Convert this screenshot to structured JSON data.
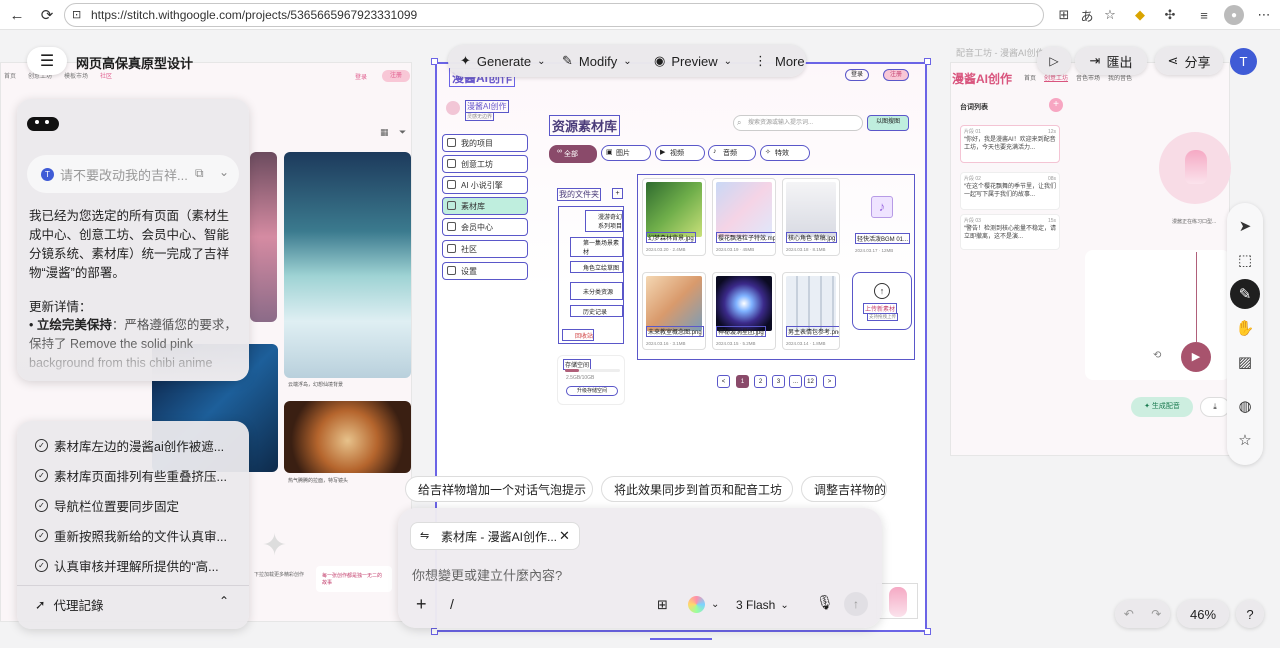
{
  "browser": {
    "url": "https://stitch.withgoogle.com/projects/5365665967923331099",
    "avatar_initial": "T"
  },
  "toolbar": {
    "menu_title": "网页高保真原型设计",
    "generate": "Generate",
    "modify": "Modify",
    "preview": "Preview",
    "more": "More",
    "export": "匯出",
    "share": "分享",
    "avatar": "T"
  },
  "left_panel": {
    "input_placeholder": "请不要改动我的吉祥...",
    "message_intro": "我已经为您选定的所有页面（素材生成中心、创意工坊、会员中心、智能分镜系统、素材库）统一完成了吉祥物“漫酱”的部署。",
    "update_heading": "更新详情：",
    "bullet_bold": "立绘完美保持",
    "bullet_text": "：严格遵循您的要求，保持了 Remove the solid pink background from this chibi anime",
    "todos": [
      "素材库左边的漫酱ai创作被遮...",
      "素材库页面排列有些重叠挤压...",
      "导航栏位置要同步固定",
      "重新按照我新给的文件认真审...",
      "认真审核并理解所提供的“高..."
    ],
    "agent_log": "代理記錄"
  },
  "bg_page_left": {
    "nav": [
      "首页",
      "创意工坊",
      "模板市场",
      "社区"
    ],
    "login": "登录",
    "register": "注册",
    "caption1": "云端浮岛，幻想仙境背景",
    "caption2": "热气腾腾的拉面，特写镜头",
    "bottom_text": "下拉加载更多精彩创作",
    "bottom_card": "每一张创作都是独一无二的故事"
  },
  "frame": {
    "brand": "漫酱AI创作",
    "brand_sub": "灵感无边界",
    "title": "资源素材库",
    "search_placeholder": "搜索资源或输入提示词...",
    "upload_btn": "以图搜图",
    "login": "登录",
    "register": "注册",
    "sidebar": [
      "我的项目",
      "创意工坊",
      "AI 小说引擎",
      "素材库",
      "会员中心",
      "社区",
      "设置"
    ],
    "filters": [
      "全部",
      "图片",
      "视频",
      "音频",
      "特效"
    ],
    "folder_title": "我的文件夹",
    "folders": [
      "漫游奇幻系列项目",
      "第一集场景素材",
      "角色立绘草图",
      "未分类资源",
      "历史记录",
      "回收站"
    ],
    "storage_title": "存储空间",
    "storage_value": "2.5GB/10GB",
    "storage_btn": "升级存储空间",
    "assets": [
      {
        "name": "幻梦森林背景.jpg",
        "meta": "2024.03.20 · 2.4MB"
      },
      {
        "name": "樱花飘落粒子特效.mp4",
        "meta": "2024.03.19 · 45MB"
      },
      {
        "name": "核心角色 草稿.jpg",
        "meta": "2024.03.18 · 8.1MB"
      },
      {
        "name": "轻快活泼BGM 01...",
        "meta": "2024.03.17 · 12MB"
      },
      {
        "name": "未来教室概念图.png",
        "meta": "2024.03.16 · 3.1MB"
      },
      {
        "name": "神秘漩涡星团.jpg",
        "meta": "2024.03.15 · 5.2MB"
      },
      {
        "name": "男主表情包参考.png",
        "meta": "2024.03.14 · 1.8MB"
      }
    ],
    "upload_card_title": "上传新素材",
    "upload_card_sub": "支持拖拽上传",
    "pages": [
      "<",
      "1",
      "2",
      "3",
      "...",
      "12",
      ">"
    ]
  },
  "suggestions": [
    {
      "text": "给吉祥物增加一个对话气泡提示",
      "n": "1"
    },
    {
      "text": "将此效果同步到首页和配音工坊",
      "n": "2"
    },
    {
      "text": "调整吉祥物的大小",
      "n": ""
    }
  ],
  "composer": {
    "context_chip": "素材库 - 漫酱AI创作...",
    "placeholder": "你想變更或建立什麼內容?",
    "slash": "/",
    "model": "3 Flash"
  },
  "right_bg": {
    "crumb": "配音工坊 - 漫酱AI创作",
    "brand": "漫酱AI创作",
    "nav": [
      "首页",
      "创意工坊",
      "音色市场",
      "我的音色"
    ],
    "list_title": "台词列表",
    "lines": [
      {
        "tag": "片段 01",
        "time": "12s",
        "text": "“你好，我是漫酱AI！欢迎来到配音工坊，今天也要充满活力..."
      },
      {
        "tag": "片段 02",
        "time": "08s",
        "text": "“在这个樱花飘舞的季节里，让我们一起写下属于我们的故事..."
      },
      {
        "tag": "片段 03",
        "time": "15s",
        "text": "“警告！检测到核心能量不稳定，请立即撤离，这不是演..."
      }
    ],
    "avatar_caption": "漫酱正在练习口型...",
    "gen_btn": "生成配音"
  },
  "zoom": "46%"
}
